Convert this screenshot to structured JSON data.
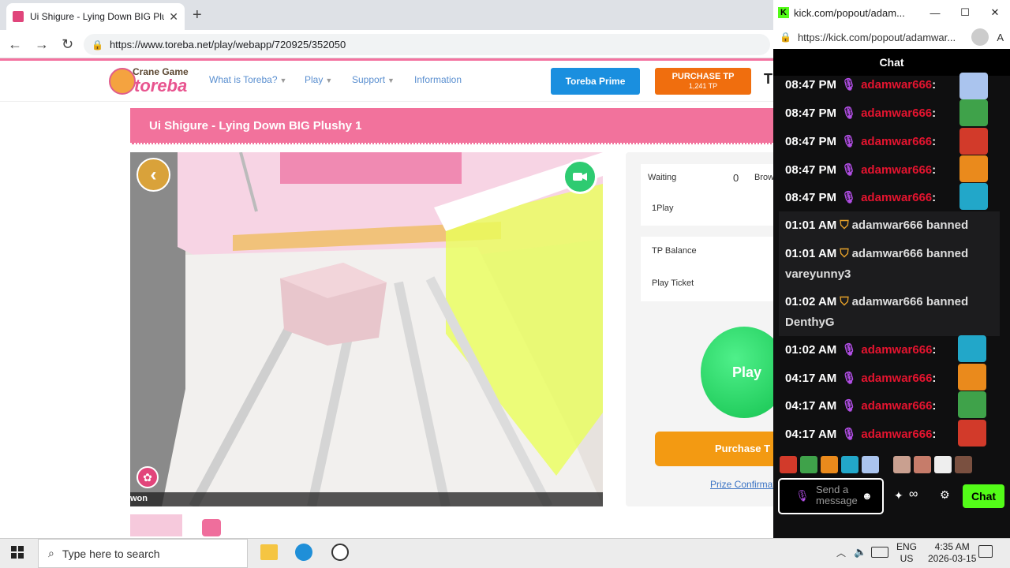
{
  "browser": {
    "tab_title": "Ui Shigure - Lying Down BIG Plush",
    "url": "https://www.toreba.net/play/webapp/720925/352050"
  },
  "site": {
    "logo_top": "Crane Game",
    "logo_main": "toreba",
    "menu": [
      "What is Toreba?",
      "Play",
      "Support",
      "Information"
    ],
    "prime_label": "Toreba Prime",
    "purchase_tp_label": "PURCHASE TP",
    "purchase_tp_amount": "1,241 TP",
    "header_letter": "T"
  },
  "game": {
    "title": "Ui Shigure - Lying Down BIG Plushy 1",
    "waiting_label": "Waiting",
    "waiting_count": "0",
    "browsing_label": "Brow",
    "oneplay_label": "1Play",
    "tp_balance_label": "TP Balance",
    "play_ticket_label": "Play Ticket",
    "play_button": "Play",
    "purchase_tp_button": "Purchase T",
    "prize_confirm": "Prize Confirmati",
    "won_label": "won"
  },
  "chat": {
    "window_title": "kick.com/popout/adam...",
    "url": "https://kick.com/popout/adamwar...",
    "header": "Chat",
    "messages": [
      {
        "time": "08:47 PM",
        "user": "adamwar666",
        "kind": "emote"
      },
      {
        "time": "08:47 PM",
        "user": "adamwar666",
        "kind": "emote"
      },
      {
        "time": "08:47 PM",
        "user": "adamwar666",
        "kind": "emote"
      },
      {
        "time": "08:47 PM",
        "user": "adamwar666",
        "kind": "emote"
      },
      {
        "time": "08:47 PM",
        "user": "adamwar666",
        "kind": "emote"
      },
      {
        "time": "01:01 AM",
        "user": "adamwar666",
        "kind": "ban",
        "action": "banned",
        "target": ""
      },
      {
        "time": "01:01 AM",
        "user": "adamwar666",
        "kind": "ban",
        "action": "banned",
        "target": "vareyunny3"
      },
      {
        "time": "01:02 AM",
        "user": "adamwar666",
        "kind": "ban",
        "action": "banned",
        "target": "DenthyG"
      },
      {
        "time": "01:02 AM",
        "user": "adamwar666",
        "kind": "emote"
      },
      {
        "time": "04:17 AM",
        "user": "adamwar666",
        "kind": "emote"
      },
      {
        "time": "04:17 AM",
        "user": "adamwar666",
        "kind": "emote"
      },
      {
        "time": "04:17 AM",
        "user": "adamwar666",
        "kind": "emote"
      }
    ],
    "input_placeholder": "Send a message",
    "send_label": "Chat"
  },
  "taskbar": {
    "search_placeholder": "Type here to search",
    "lang": "ENG",
    "region": "US",
    "time": "4:35 AM",
    "date": "2026-03-15"
  },
  "colors": {
    "toreba_pink": "#f2729c",
    "kick_green": "#53fc18",
    "username_red": "#e5142f",
    "mic_purple": "#b24ee6"
  }
}
